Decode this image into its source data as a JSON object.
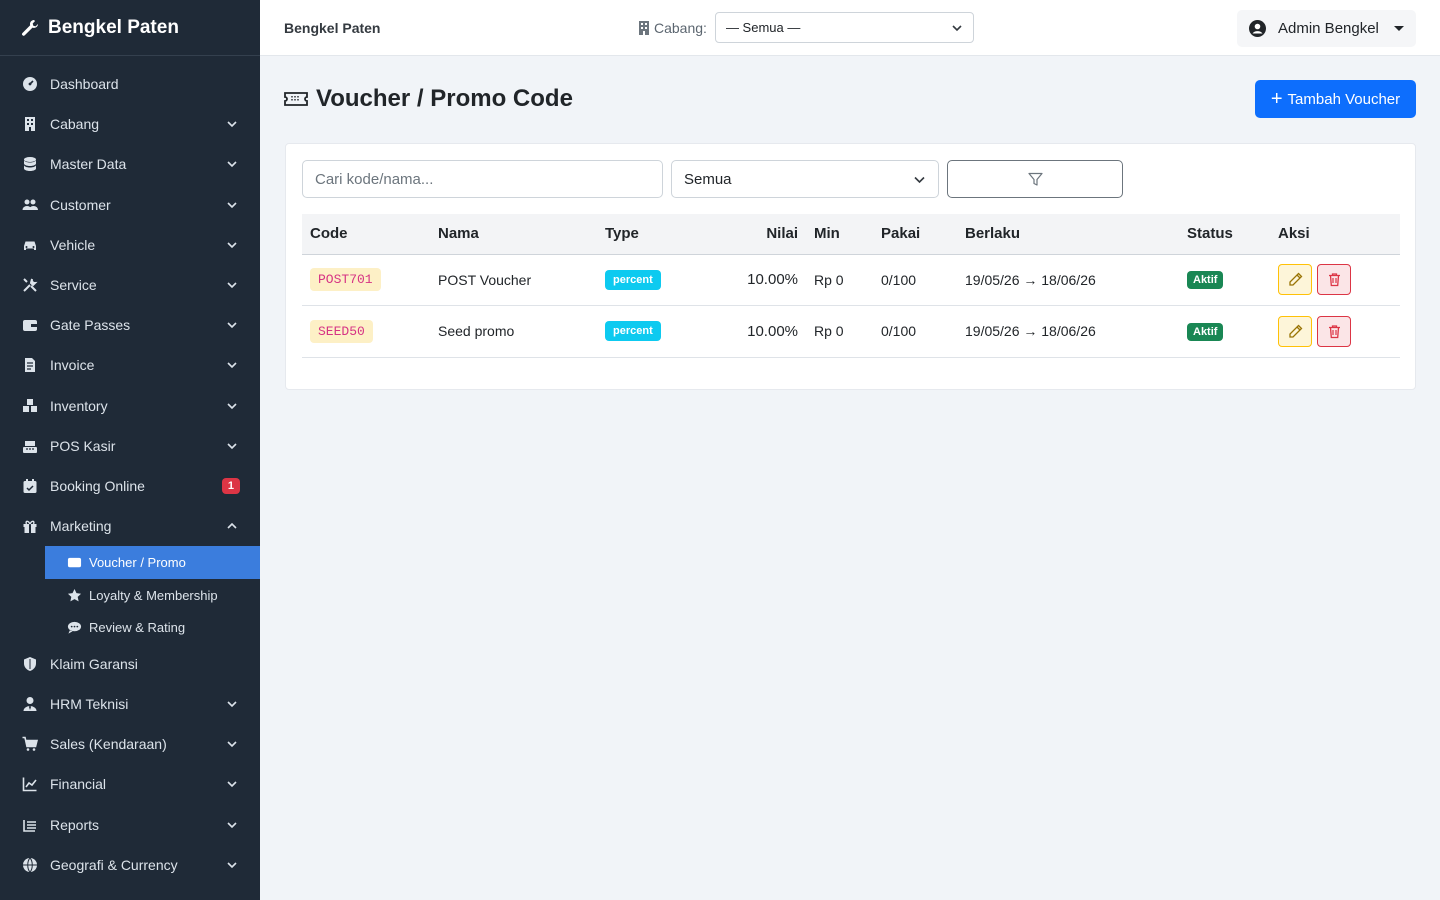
{
  "sidebar": {
    "brand": "Bengkel Paten",
    "items": [
      {
        "label": "Dashboard",
        "icon": "gauge-icon",
        "chevron": false
      },
      {
        "label": "Cabang",
        "icon": "building-icon",
        "chevron": true
      },
      {
        "label": "Master Data",
        "icon": "database-icon",
        "chevron": true
      },
      {
        "label": "Customer",
        "icon": "users-icon",
        "chevron": true
      },
      {
        "label": "Vehicle",
        "icon": "car-icon",
        "chevron": true
      },
      {
        "label": "Service",
        "icon": "tools-icon",
        "chevron": true
      },
      {
        "label": "Gate Passes",
        "icon": "wallet-icon",
        "chevron": true
      },
      {
        "label": "Invoice",
        "icon": "file-invoice-icon",
        "chevron": true
      },
      {
        "label": "Inventory",
        "icon": "boxes-icon",
        "chevron": true
      },
      {
        "label": "POS Kasir",
        "icon": "cash-register-icon",
        "chevron": true
      },
      {
        "label": "Booking Online",
        "icon": "calendar-check-icon",
        "badge": "1"
      },
      {
        "label": "Marketing",
        "icon": "gift-icon",
        "chevron": "up"
      }
    ],
    "marketing_sub": [
      {
        "label": "Voucher / Promo",
        "icon": "ticket-icon",
        "active": true
      },
      {
        "label": "Loyalty & Membership",
        "icon": "star-icon",
        "active": false
      },
      {
        "label": "Review & Rating",
        "icon": "comment-icon",
        "active": false
      }
    ],
    "items_after": [
      {
        "label": "Klaim Garansi",
        "icon": "shield-icon",
        "chevron": false
      },
      {
        "label": "HRM Teknisi",
        "icon": "user-tie-icon",
        "chevron": true
      },
      {
        "label": "Sales (Kendaraan)",
        "icon": "cart-icon",
        "chevron": true
      },
      {
        "label": "Financial",
        "icon": "chart-line-icon",
        "chevron": true
      },
      {
        "label": "Reports",
        "icon": "list-icon",
        "chevron": true
      },
      {
        "label": "Geografi & Currency",
        "icon": "globe-icon",
        "chevron": true
      }
    ]
  },
  "topbar": {
    "brand": "Bengkel Paten",
    "cabang_label": "Cabang:",
    "cabang_value": "— Semua —",
    "user": "Admin Bengkel"
  },
  "page": {
    "title": "Voucher / Promo Code",
    "add_button": "Tambah Voucher"
  },
  "filters": {
    "search_placeholder": "Cari kode/nama...",
    "status_value": "Semua"
  },
  "table": {
    "headers": [
      "Code",
      "Nama",
      "Type",
      "Nilai",
      "Min",
      "Pakai",
      "Berlaku",
      "Status",
      "Aksi"
    ],
    "rows": [
      {
        "code": "POST701",
        "nama": "POST Voucher",
        "type": "percent",
        "nilai": "10.00%",
        "min": "Rp 0",
        "pakai": "0/100",
        "berlaku": "19/05/26 → 18/06/26",
        "status": "Aktif"
      },
      {
        "code": "SEED50",
        "nama": "Seed promo",
        "type": "percent",
        "nilai": "10.00%",
        "min": "Rp 0",
        "pakai": "0/100",
        "berlaku": "19/05/26 → 18/06/26",
        "status": "Aktif"
      }
    ]
  },
  "colors": {
    "sidebar_bg": "#1f2a37",
    "active_item": "#3b7ddd",
    "primary": "#0d6efd",
    "info": "#0dcaf0",
    "success": "#198754",
    "danger": "#dc3545",
    "warning": "#ffc107"
  }
}
